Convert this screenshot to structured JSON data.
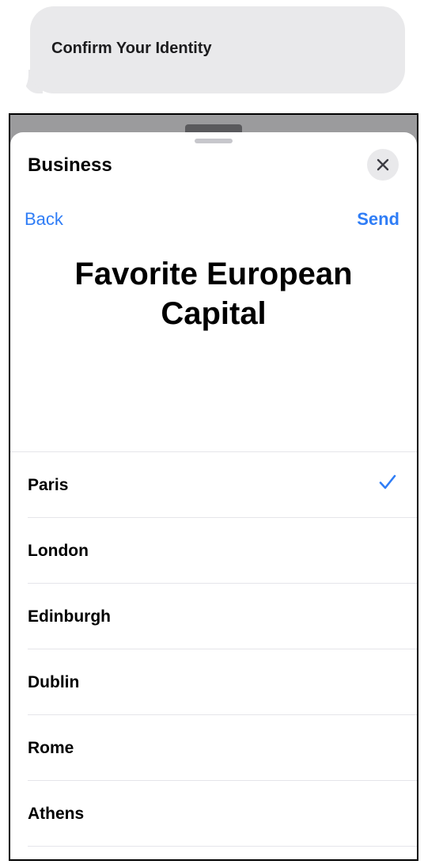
{
  "message": {
    "text": "Confirm Your Identity"
  },
  "sheet": {
    "title": "Business",
    "close_icon": "close-icon",
    "nav": {
      "back_label": "Back",
      "send_label": "Send"
    },
    "heading": "Favorite European Capital"
  },
  "options": [
    {
      "label": "Paris",
      "selected": true
    },
    {
      "label": "London",
      "selected": false
    },
    {
      "label": "Edinburgh",
      "selected": false
    },
    {
      "label": "Dublin",
      "selected": false
    },
    {
      "label": "Rome",
      "selected": false
    },
    {
      "label": "Athens",
      "selected": false
    }
  ],
  "colors": {
    "accent": "#2f7df6",
    "bubble": "#e9e9eb",
    "separator": "#e5e5ea"
  }
}
